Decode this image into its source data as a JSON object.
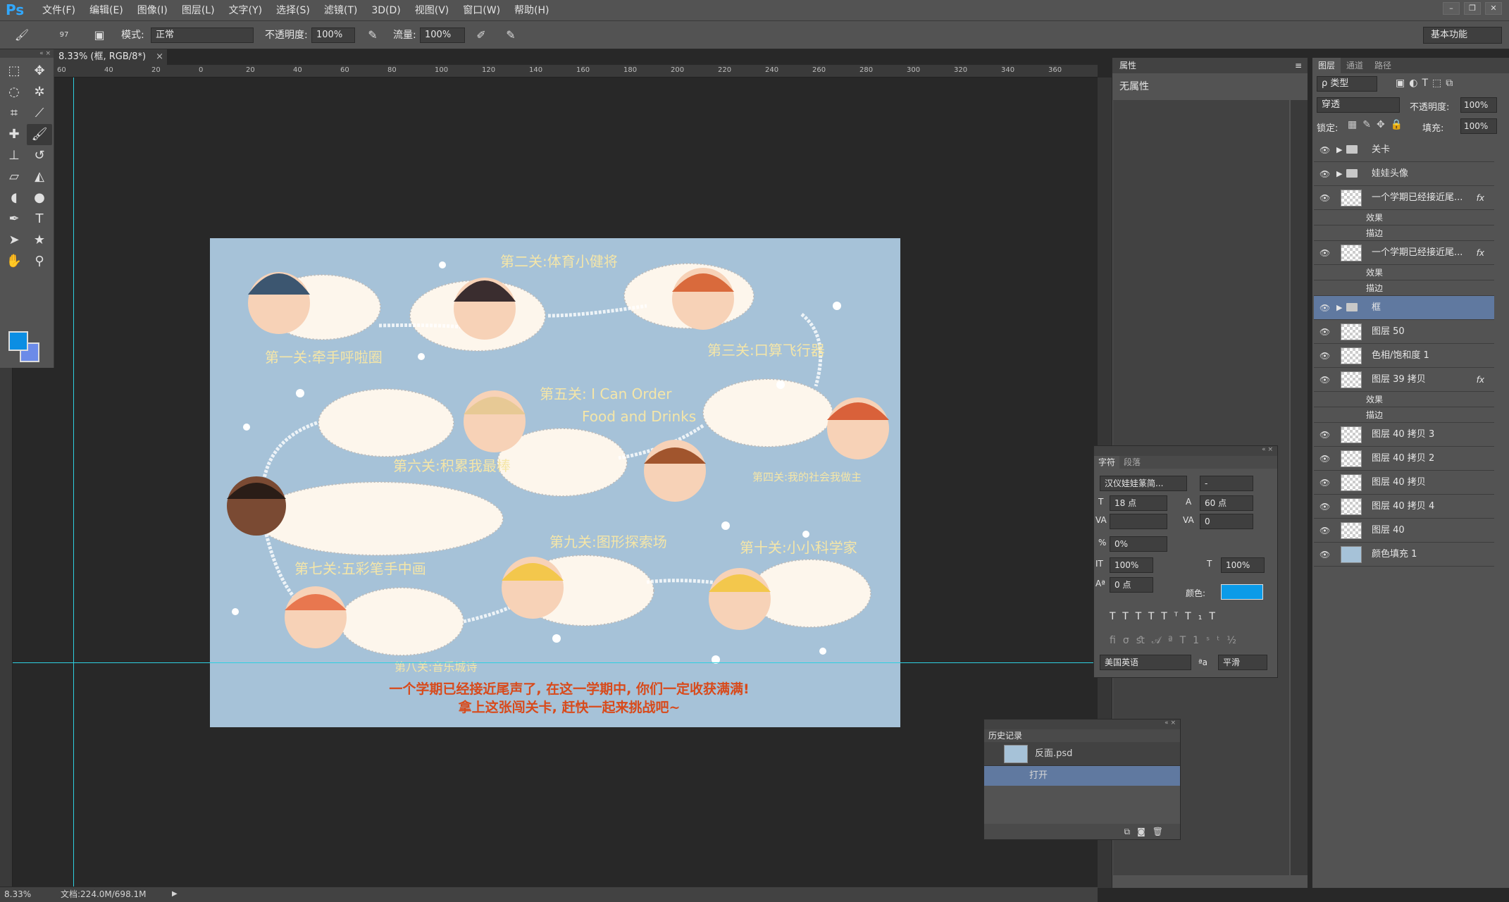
{
  "app": {
    "logo": "Ps"
  },
  "menu": [
    "文件(F)",
    "编辑(E)",
    "图像(I)",
    "图层(L)",
    "文字(Y)",
    "选择(S)",
    "滤镜(T)",
    "3D(D)",
    "视图(V)",
    "窗口(W)",
    "帮助(H)"
  ],
  "options": {
    "brush_size": "97",
    "mode_label": "模式:",
    "mode_value": "正常",
    "opacity_label": "不透明度:",
    "opacity_value": "100%",
    "flow_label": "流量:",
    "flow_value": "100%",
    "workspace": "基本功能"
  },
  "document": {
    "tab": "8.33% (框, RGB/8*)",
    "close": "×"
  },
  "ruler_ticks": [
    "60",
    "40",
    "20",
    "0",
    "20",
    "40",
    "60",
    "80",
    "100",
    "120",
    "140",
    "160",
    "180",
    "200",
    "220",
    "240",
    "260",
    "280",
    "300",
    "320",
    "340",
    "360"
  ],
  "status": {
    "zoom": "8.33%",
    "doc": "文档:224.0M/698.1M"
  },
  "properties": {
    "title": "属性",
    "none": "无属性"
  },
  "layers": {
    "tabs": [
      "图层",
      "通道",
      "路径"
    ],
    "kind": "ρ 类型",
    "blend": "穿透",
    "opacity_label": "不透明度:",
    "opacity": "100%",
    "lock_label": "锁定:",
    "fill_label": "填充:",
    "fill": "100%",
    "items": [
      {
        "name": "关卡",
        "type": "group"
      },
      {
        "name": "娃娃头像",
        "type": "group"
      },
      {
        "name": "一个学期已经接近尾...",
        "type": "text",
        "fx": "fx"
      },
      {
        "name": "效果",
        "type": "sub"
      },
      {
        "name": "描边",
        "type": "sub"
      },
      {
        "name": "一个学期已经接近尾...",
        "type": "layer",
        "fx": "fx"
      },
      {
        "name": "效果",
        "type": "sub"
      },
      {
        "name": "描边",
        "type": "sub"
      },
      {
        "name": "框",
        "type": "group",
        "selected": true
      },
      {
        "name": "图层 50",
        "type": "layer"
      },
      {
        "name": "色相/饱和度 1",
        "type": "adjust"
      },
      {
        "name": "图层 39 拷贝",
        "type": "layer",
        "fx": "fx"
      },
      {
        "name": "效果",
        "type": "sub"
      },
      {
        "name": "描边",
        "type": "sub"
      },
      {
        "name": "图层 40 拷贝 3",
        "type": "layer"
      },
      {
        "name": "图层 40 拷贝 2",
        "type": "layer"
      },
      {
        "name": "图层 40 拷贝",
        "type": "layer"
      },
      {
        "name": "图层 40 拷贝 4",
        "type": "layer"
      },
      {
        "name": "图层 40",
        "type": "layer"
      },
      {
        "name": "颜色填充 1",
        "type": "fill"
      }
    ]
  },
  "character": {
    "tabs": [
      "字符",
      "段落"
    ],
    "font": "汉仪娃娃篆简...",
    "style": "-",
    "size": "18 点",
    "leading": "60 点",
    "kerning": "",
    "tracking": "0",
    "scale_pct": "0%",
    "vscale": "100%",
    "hscale": "100%",
    "baseline": "0 点",
    "color_label": "颜色:",
    "language": "美国英语",
    "aa": "平滑",
    "aa_label": "ªa"
  },
  "history": {
    "title": "历史记录",
    "snapshot": "反面.psd",
    "state": "打开"
  },
  "artwork": {
    "levels": [
      "第一关:牵手呼啦圈",
      "第二关:体育小健将",
      "第三关:口算飞行器",
      "第四关:我的社会我做主",
      "第五关: I Can Order",
      "Food and Drinks",
      "第六关:积累我最棒",
      "第七关:五彩笔手中画",
      "第八关:音乐城诗",
      "第九关:图形探索场",
      "第十关:小小科学家"
    ],
    "line1": "一个学期已经接近尾声了, 在这一学期中, 你们一定收获满满!",
    "line2": "拿上这张闯关卡, 赶快一起来挑战吧~"
  }
}
